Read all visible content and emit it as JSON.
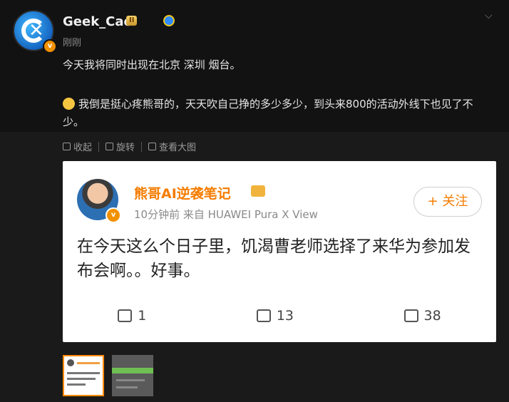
{
  "post": {
    "username": "Geek_Cao",
    "level_badge": "II",
    "time": "刚刚",
    "text_line1": "今天我将同时出现在北京 深圳 烟台。",
    "text_line2": "我倒是挺心疼熊哥的，天天吹自己挣的多少多少，到头来800的活动外线下也见了不少。",
    "actions": {
      "collapse": "收起",
      "rotate": "旋转",
      "view_large": "查看大图"
    }
  },
  "embedded_card": {
    "author": "熊哥AI逆袭笔记",
    "meta": "10分钟前  来自 HUAWEI Pura X View",
    "follow_label": "+ 关注",
    "text": "在今天这么个日子里，饥渴曹老师选择了来华为参加发布会啊。。好事。",
    "reposts": "1",
    "comments": "13",
    "likes": "38"
  },
  "colors": {
    "accent_orange": "#f57c00",
    "background": "#121212"
  }
}
